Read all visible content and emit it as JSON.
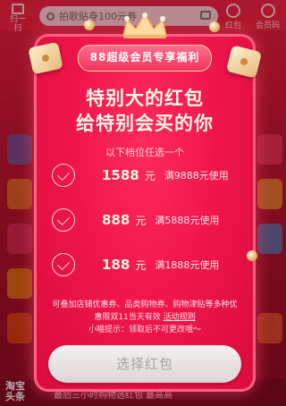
{
  "background": {
    "scan_label": "扫一扫",
    "search_placeholder": "拍歌贴身100元券",
    "red_label": "红包",
    "member_label": "会员码",
    "bottom_left": "淘宝\n头条",
    "bottom_text": "最后三小时购物选红包 最高高"
  },
  "modal": {
    "ribbon_text": "88超级会员专享福利",
    "headline_line1": "特别大的红包",
    "headline_line2": "给特别会买的你",
    "subtitle": "以下档位任选一个",
    "options": [
      {
        "amount": "1588",
        "unit": "元",
        "condition": "满9888元使用"
      },
      {
        "amount": "888",
        "unit": "元",
        "condition": "满5888元使用"
      },
      {
        "amount": "188",
        "unit": "元",
        "condition": "满1888元使用"
      }
    ],
    "note_line1": "可叠加店铺优惠券、品类购物券、购物津贴等多种优",
    "note_line2_prefix": "惠限双11当天有效 ",
    "note_link": "活动规则",
    "tip": "小喵提示：领取后不可更改哦～",
    "button_label": "选择红包"
  },
  "colors": {
    "modal_red": "#f0164a",
    "button_gray": "#ddd6d6",
    "text_cream": "#fff4de"
  }
}
